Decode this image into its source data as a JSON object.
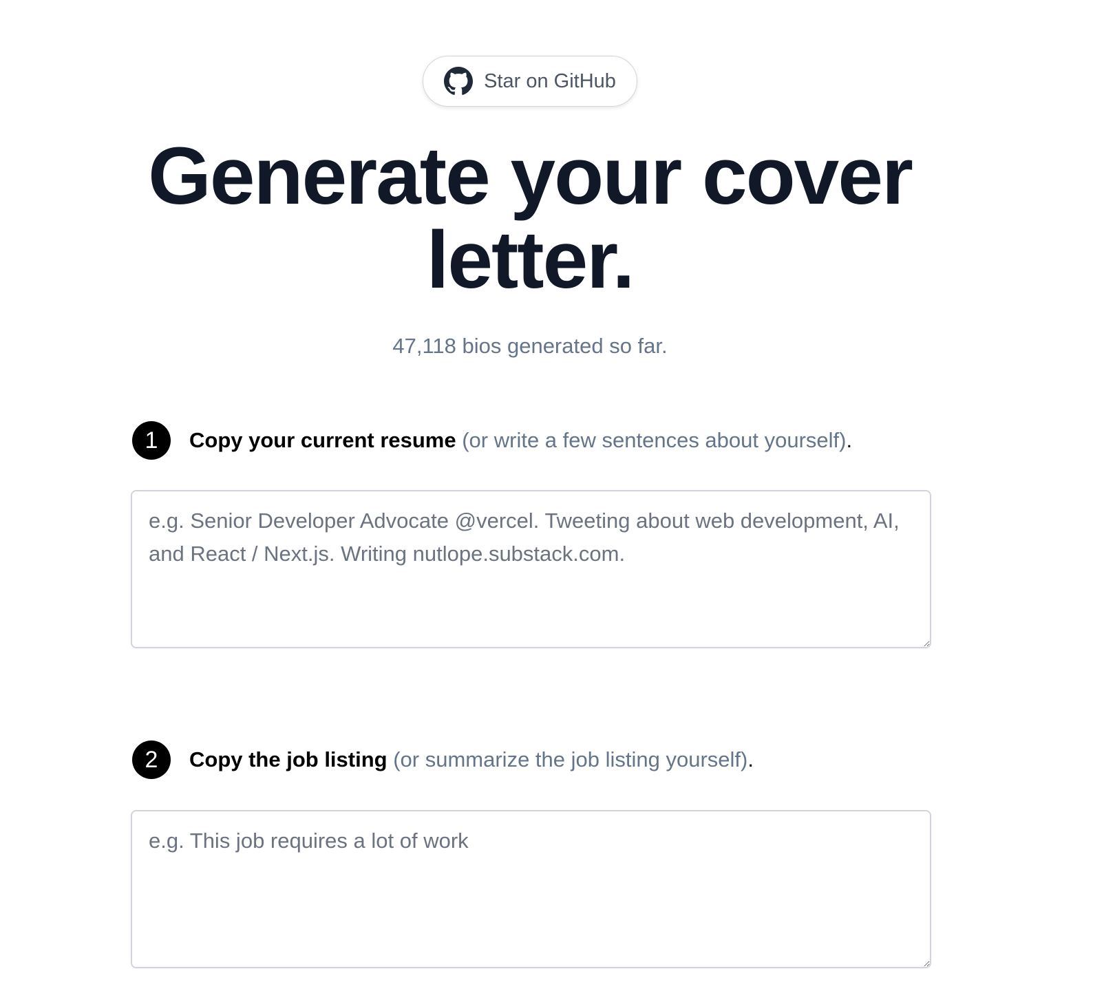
{
  "github_button": {
    "label": "Star on GitHub",
    "icon": "github-icon"
  },
  "hero": {
    "title": "Generate your cover letter.",
    "counter": "47,118 bios generated so far."
  },
  "steps": [
    {
      "number": "1",
      "title": "Copy your current resume",
      "hint": "(or write a few sentences about yourself)",
      "suffix": ".",
      "placeholder": "e.g. Senior Developer Advocate @vercel. Tweeting about web development, AI, and React / Next.js. Writing nutlope.substack.com.",
      "value": ""
    },
    {
      "number": "2",
      "title": "Copy the job listing",
      "hint": "(or summarize the job listing yourself)",
      "suffix": ".",
      "placeholder": "e.g. This job requires a lot of work",
      "value": ""
    }
  ],
  "colors": {
    "heading": "#111827",
    "muted": "#64748b",
    "badge": "#000000",
    "border": "#d1d5db"
  }
}
